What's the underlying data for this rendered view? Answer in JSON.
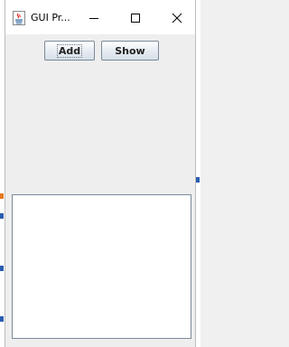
{
  "window": {
    "title": "GUI Pr...",
    "controls": {
      "minimize": "minimize-icon",
      "maximize": "maximize-icon",
      "close": "close-icon"
    }
  },
  "toolbar": {
    "add_label": "Add",
    "show_label": "Show"
  },
  "output": {
    "value": ""
  },
  "colors": {
    "titlebar": "#ffffff",
    "window_bg": "#eeeeee",
    "button_border": "#7a8a99"
  }
}
